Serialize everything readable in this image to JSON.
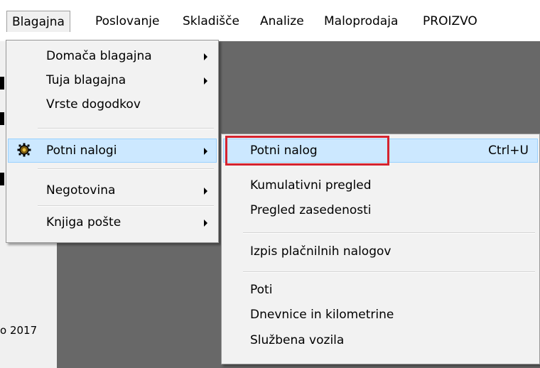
{
  "menubar": {
    "items": [
      {
        "label": "Blagajna"
      },
      {
        "label": "Poslovanje"
      },
      {
        "label": "Skladišče"
      },
      {
        "label": "Analize"
      },
      {
        "label": "Maloprodaja"
      },
      {
        "label": "PROIZVO"
      }
    ]
  },
  "status": {
    "text": "o 2017"
  },
  "menu_blagajna": {
    "items": [
      {
        "label": "Domača blagajna"
      },
      {
        "label": "Tuja blagajna"
      },
      {
        "label": "Vrste dogodkov"
      },
      {
        "label": "Potni nalogi"
      },
      {
        "label": "Negotovina"
      },
      {
        "label": "Knjiga pošte"
      }
    ]
  },
  "menu_potni": {
    "items": [
      {
        "label": "Potni nalog",
        "shortcut": "Ctrl+U"
      },
      {
        "label": "Kumulativni pregled"
      },
      {
        "label": "Pregled zasedenosti"
      },
      {
        "label": "Izpis plačnilnih nalogov"
      },
      {
        "label": "Poti"
      },
      {
        "label": "Dnevnice in kilometrine"
      },
      {
        "label": "Službena vozila"
      }
    ]
  },
  "colors": {
    "highlight": "#cce8ff",
    "annotation": "#d5232f",
    "background": "#686868"
  }
}
